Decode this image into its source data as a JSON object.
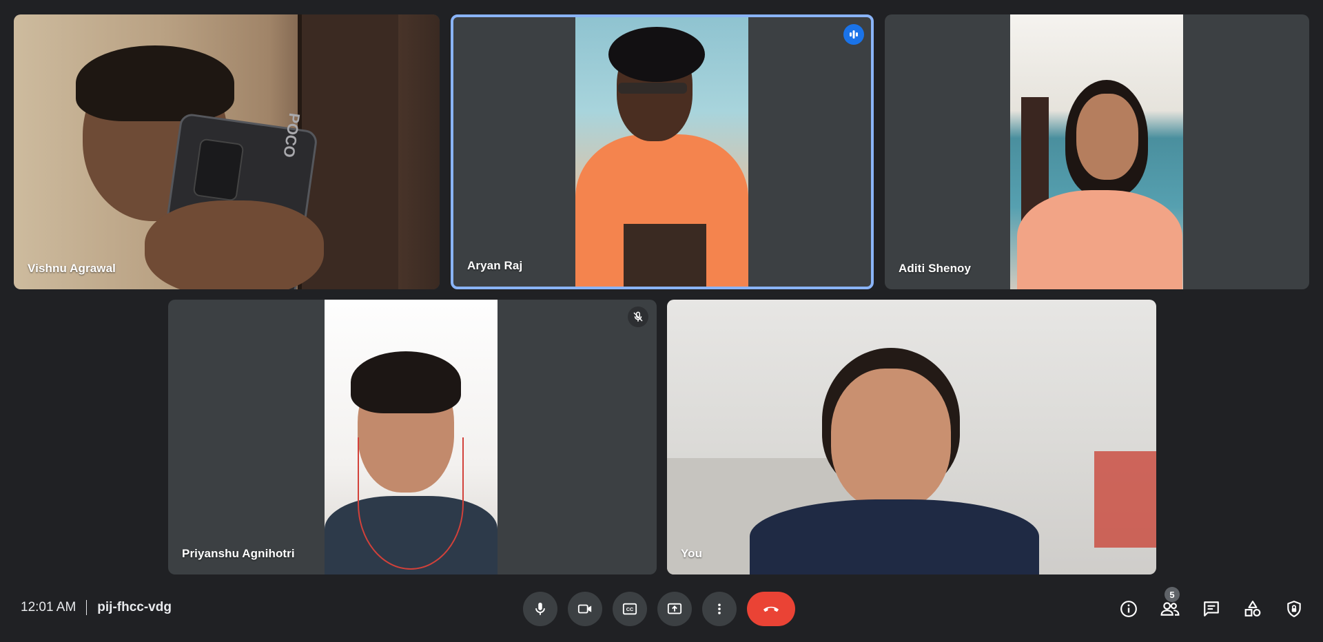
{
  "participants": [
    {
      "name": "Vishnu Agrawal",
      "speaking": false,
      "muted": false
    },
    {
      "name": "Aryan Raj",
      "speaking": true,
      "muted": false
    },
    {
      "name": "Aditi Shenoy",
      "speaking": false,
      "muted": false
    },
    {
      "name": "Priyanshu Agnihotri",
      "speaking": false,
      "muted": true
    },
    {
      "name": "You",
      "speaking": false,
      "muted": false
    }
  ],
  "tile_extras": {
    "phone_brand": "POCO"
  },
  "meeting": {
    "time": "12:01 AM",
    "code": "pij-fhcc-vdg"
  },
  "controls": [
    {
      "id": "mic",
      "icon": "microphone-icon"
    },
    {
      "id": "camera",
      "icon": "video-camera-icon"
    },
    {
      "id": "captions",
      "icon": "closed-captions-icon"
    },
    {
      "id": "present",
      "icon": "present-screen-icon"
    },
    {
      "id": "more",
      "icon": "more-vertical-icon"
    },
    {
      "id": "leave",
      "icon": "end-call-icon"
    }
  ],
  "side_panel": {
    "participant_count": "5",
    "icons": [
      "info-icon",
      "people-icon",
      "chat-icon",
      "activities-icon",
      "host-controls-icon"
    ]
  },
  "colors": {
    "background": "#202124",
    "tile": "#3c4043",
    "speaking_border": "#8ab4f8",
    "speaking_badge": "#1a73e8",
    "end_call": "#ea4335"
  }
}
